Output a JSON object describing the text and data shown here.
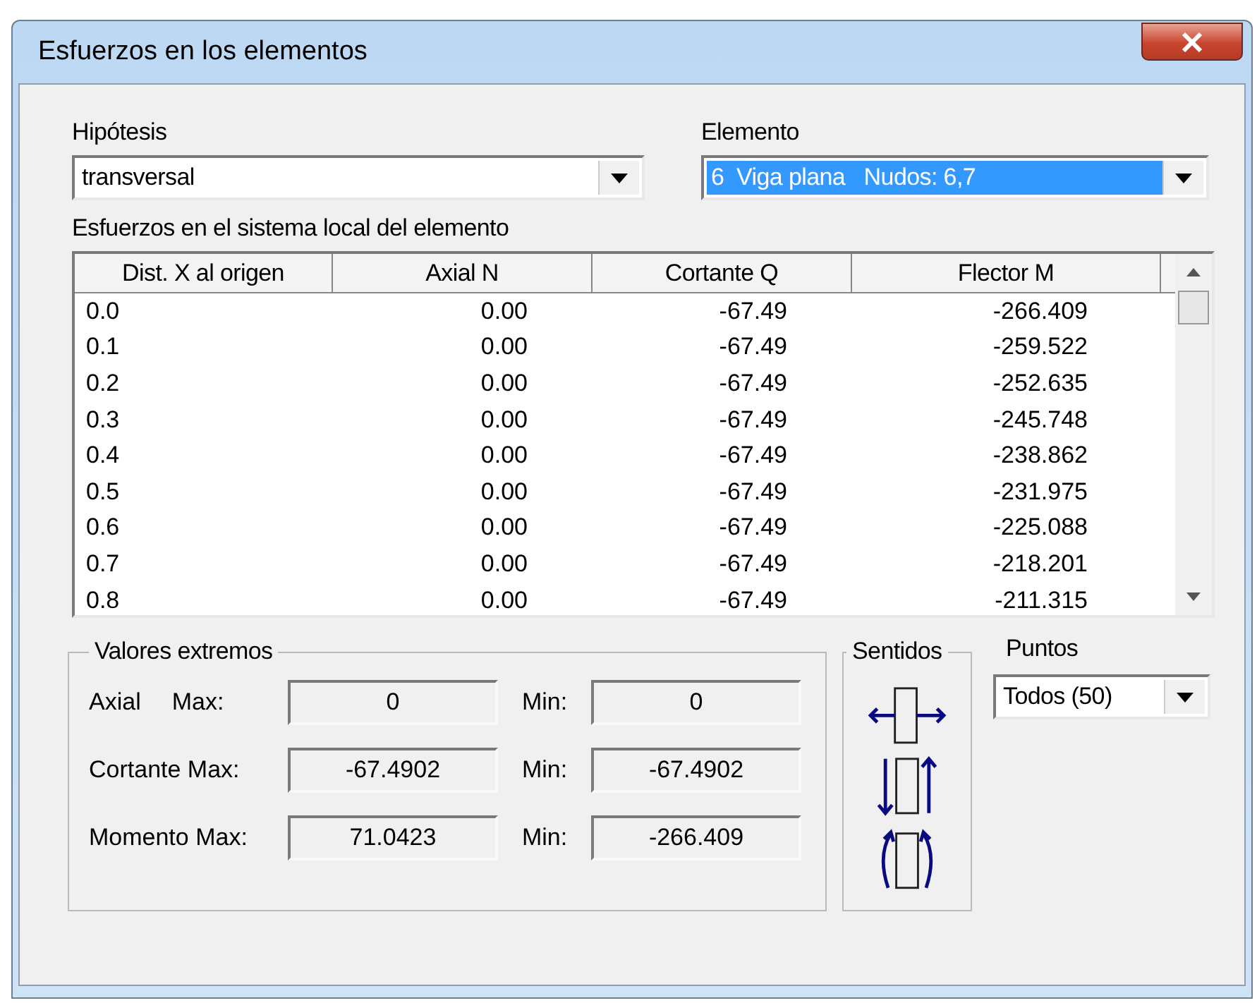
{
  "window": {
    "title": "Esfuerzos en los elementos"
  },
  "hipotesis": {
    "label": "Hipótesis",
    "value": "transversal",
    "selected": false
  },
  "elemento": {
    "label": "Elemento",
    "value": "6  Viga plana   Nudos: 6,7",
    "selected": true
  },
  "table": {
    "caption": "Esfuerzos en el sistema local del elemento",
    "columns": [
      "Dist. X al origen",
      "Axial N",
      "Cortante Q",
      "Flector M"
    ],
    "rows": [
      [
        "0.0",
        "0.00",
        "-67.49",
        "-266.409"
      ],
      [
        "0.1",
        "0.00",
        "-67.49",
        "-259.522"
      ],
      [
        "0.2",
        "0.00",
        "-67.49",
        "-252.635"
      ],
      [
        "0.3",
        "0.00",
        "-67.49",
        "-245.748"
      ],
      [
        "0.4",
        "0.00",
        "-67.49",
        "-238.862"
      ],
      [
        "0.5",
        "0.00",
        "-67.49",
        "-231.975"
      ],
      [
        "0.6",
        "0.00",
        "-67.49",
        "-225.088"
      ],
      [
        "0.7",
        "0.00",
        "-67.49",
        "-218.201"
      ],
      [
        "0.8",
        "0.00",
        "-67.49",
        "-211.315"
      ]
    ]
  },
  "extremos": {
    "title": "Valores extremos",
    "rows": [
      {
        "label": "Axial",
        "max_label": "Max:",
        "max": "0",
        "min_label": "Min:",
        "min": "0"
      },
      {
        "label": "Cortante Max:",
        "max": "-67.4902",
        "min_label": "Min:",
        "min": "-67.4902"
      },
      {
        "label": "Momento Max:",
        "max": "71.0423",
        "min_label": "Min:",
        "min": "-266.409"
      }
    ]
  },
  "sentidos": {
    "title": "Sentidos"
  },
  "puntos": {
    "label": "Puntos",
    "value": "Todos (50)"
  }
}
